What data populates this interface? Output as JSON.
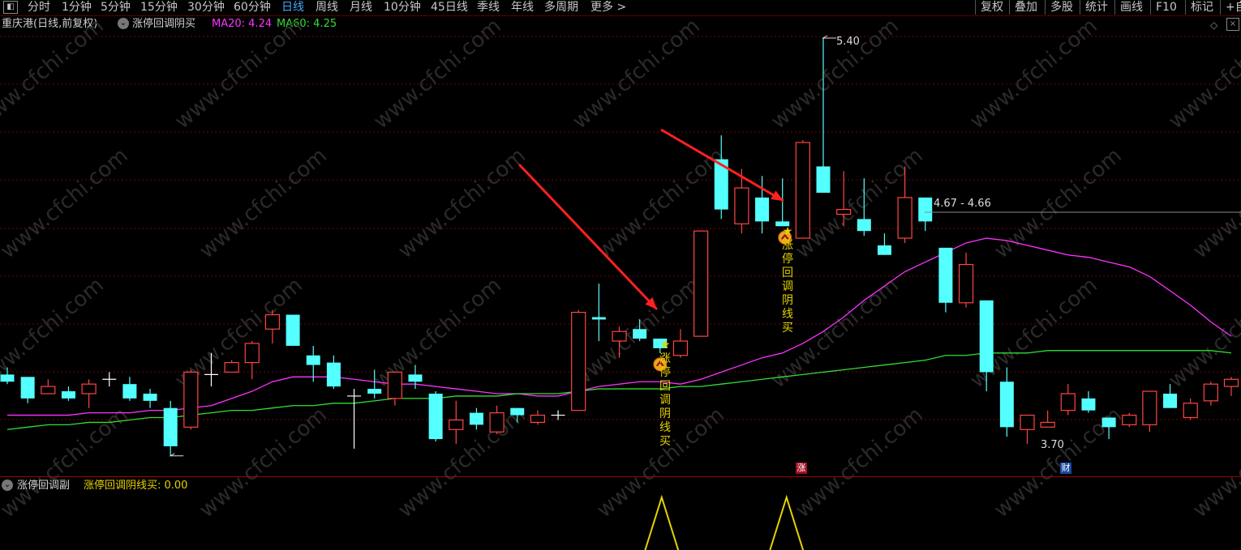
{
  "toolbar": {
    "toggle_icon": "window-toggle-icon",
    "periods": [
      "分时",
      "1分钟",
      "5分钟",
      "15分钟",
      "30分钟",
      "60分钟",
      "日线",
      "周线",
      "月线",
      "10分钟",
      "45日线",
      "季线",
      "年线",
      "多周期",
      "更多 >"
    ],
    "active_period": "日线",
    "right_buttons": [
      "复权",
      "叠加",
      "多股",
      "统计",
      "画线",
      "F10",
      "标记",
      "+自"
    ]
  },
  "main": {
    "stock_title": "重庆港(日线,前复权)",
    "indicator_name": "涨停回调阴买",
    "ma20_label": "MA20: 4.24",
    "ma60_label": "MA60: 4.25",
    "high_label": "5.40",
    "low_label": "3.70",
    "range_label": "4.67 - 4.66",
    "signal_text": "涨停回调阴线买",
    "zhang_badge": "涨",
    "cai_badge": "财"
  },
  "sub": {
    "indicator_name": "涨停回调副",
    "value_label": "涨停回调阴线买: 0.00"
  },
  "watermark": "www.cfchi.com",
  "colors": {
    "up": "#ff4444",
    "down": "#54ffff",
    "ma20": "#ff33ff",
    "ma60": "#33dd33",
    "signal": "#e6d200",
    "grid": "#7a0000",
    "arrow": "#ff2020",
    "active": "#3fa9ff"
  },
  "chart_data": {
    "type": "candlestick",
    "price_range": [
      3.7,
      5.4
    ],
    "candles": [
      {
        "o": 3.99,
        "c": 3.96,
        "h": 4.02,
        "l": 3.95
      },
      {
        "o": 3.98,
        "c": 3.89,
        "h": 3.98,
        "l": 3.87
      },
      {
        "o": 3.91,
        "c": 3.94,
        "h": 3.97,
        "l": 3.91
      },
      {
        "o": 3.92,
        "c": 3.89,
        "h": 3.94,
        "l": 3.88
      },
      {
        "o": 3.91,
        "c": 3.95,
        "h": 3.97,
        "l": 3.85
      },
      {
        "o": 3.97,
        "c": 3.97,
        "h": 4.0,
        "l": 3.94
      },
      {
        "o": 3.95,
        "c": 3.89,
        "h": 3.98,
        "l": 3.88
      },
      {
        "o": 3.91,
        "c": 3.88,
        "h": 3.93,
        "l": 3.85
      },
      {
        "o": 3.85,
        "c": 3.69,
        "h": 3.88,
        "l": 3.65
      },
      {
        "o": 3.77,
        "c": 4.0,
        "h": 4.01,
        "l": 3.76
      },
      {
        "o": 3.99,
        "c": 3.99,
        "h": 4.08,
        "l": 3.94
      },
      {
        "o": 4.0,
        "c": 4.04,
        "h": 4.05,
        "l": 4.0
      },
      {
        "o": 4.04,
        "c": 4.12,
        "h": 4.13,
        "l": 3.97
      },
      {
        "o": 4.18,
        "c": 4.24,
        "h": 4.26,
        "l": 4.12
      },
      {
        "o": 4.24,
        "c": 4.11,
        "h": 4.24,
        "l": 4.11
      },
      {
        "o": 4.07,
        "c": 4.03,
        "h": 4.11,
        "l": 3.96
      },
      {
        "o": 4.04,
        "c": 3.94,
        "h": 4.07,
        "l": 3.93
      },
      {
        "o": 3.9,
        "c": 3.9,
        "h": 3.93,
        "l": 3.68
      },
      {
        "o": 3.93,
        "c": 3.91,
        "h": 4.01,
        "l": 3.89
      },
      {
        "o": 3.89,
        "c": 4.0,
        "h": 4.0,
        "l": 3.86
      },
      {
        "o": 3.99,
        "c": 3.96,
        "h": 4.03,
        "l": 3.93
      },
      {
        "o": 3.91,
        "c": 3.72,
        "h": 3.92,
        "l": 3.71
      },
      {
        "o": 3.76,
        "c": 3.8,
        "h": 3.88,
        "l": 3.7
      },
      {
        "o": 3.83,
        "c": 3.78,
        "h": 3.85,
        "l": 3.76
      },
      {
        "o": 3.75,
        "c": 3.83,
        "h": 3.86,
        "l": 3.74
      },
      {
        "o": 3.85,
        "c": 3.82,
        "h": 3.85,
        "l": 3.79
      },
      {
        "o": 3.79,
        "c": 3.82,
        "h": 3.84,
        "l": 3.78
      },
      {
        "o": 3.82,
        "c": 3.82,
        "h": 3.84,
        "l": 3.8
      },
      {
        "o": 3.84,
        "c": 4.25,
        "h": 4.26,
        "l": 3.84
      },
      {
        "o": 4.23,
        "c": 4.22,
        "h": 4.37,
        "l": 4.13
      },
      {
        "o": 4.13,
        "c": 4.17,
        "h": 4.19,
        "l": 4.06
      },
      {
        "o": 4.18,
        "c": 4.14,
        "h": 4.22,
        "l": 4.13
      },
      {
        "o": 4.14,
        "c": 4.1,
        "h": 4.14,
        "l": 4.08
      },
      {
        "o": 4.07,
        "c": 4.13,
        "h": 4.18,
        "l": 4.06
      },
      {
        "o": 4.15,
        "c": 4.59,
        "h": 4.59,
        "l": 4.15
      },
      {
        "o": 4.89,
        "c": 4.68,
        "h": 4.99,
        "l": 4.64
      },
      {
        "o": 4.62,
        "c": 4.77,
        "h": 4.85,
        "l": 4.58
      },
      {
        "o": 4.73,
        "c": 4.63,
        "h": 4.82,
        "l": 4.58
      },
      {
        "o": 4.63,
        "c": 4.61,
        "h": 4.81,
        "l": 4.61
      },
      {
        "o": 4.56,
        "c": 4.96,
        "h": 4.97,
        "l": 4.56
      },
      {
        "o": 4.86,
        "c": 4.75,
        "h": 5.4,
        "l": 4.75
      },
      {
        "o": 4.66,
        "c": 4.68,
        "h": 4.84,
        "l": 4.61
      },
      {
        "o": 4.64,
        "c": 4.59,
        "h": 4.81,
        "l": 4.57
      },
      {
        "o": 4.53,
        "c": 4.49,
        "h": 4.58,
        "l": 4.49
      },
      {
        "o": 4.56,
        "c": 4.73,
        "h": 4.86,
        "l": 4.54
      },
      {
        "o": 4.73,
        "c": 4.63,
        "h": 4.73,
        "l": 4.59
      },
      {
        "o": 4.52,
        "c": 4.29,
        "h": 4.52,
        "l": 4.25
      },
      {
        "o": 4.29,
        "c": 4.45,
        "h": 4.5,
        "l": 4.27
      },
      {
        "o": 4.3,
        "c": 4.0,
        "h": 4.3,
        "l": 3.92
      },
      {
        "o": 3.96,
        "c": 3.77,
        "h": 4.02,
        "l": 3.73
      },
      {
        "o": 3.76,
        "c": 3.82,
        "h": 3.82,
        "l": 3.7
      },
      {
        "o": 3.77,
        "c": 3.79,
        "h": 3.84,
        "l": 3.77
      },
      {
        "o": 3.84,
        "c": 3.91,
        "h": 3.95,
        "l": 3.82
      },
      {
        "o": 3.89,
        "c": 3.84,
        "h": 3.92,
        "l": 3.83
      },
      {
        "o": 3.81,
        "c": 3.77,
        "h": 3.81,
        "l": 3.72
      },
      {
        "o": 3.78,
        "c": 3.82,
        "h": 3.83,
        "l": 3.77
      },
      {
        "o": 3.78,
        "c": 3.92,
        "h": 3.92,
        "l": 3.75
      },
      {
        "o": 3.91,
        "c": 3.85,
        "h": 3.95,
        "l": 3.85
      },
      {
        "o": 3.81,
        "c": 3.87,
        "h": 3.89,
        "l": 3.8
      },
      {
        "o": 3.88,
        "c": 3.95,
        "h": 3.96,
        "l": 3.86
      },
      {
        "o": 3.94,
        "c": 3.97,
        "h": 3.98,
        "l": 3.9
      }
    ],
    "ma20": [
      3.82,
      3.82,
      3.82,
      3.82,
      3.83,
      3.83,
      3.83,
      3.84,
      3.84,
      3.85,
      3.86,
      3.89,
      3.92,
      3.96,
      3.98,
      3.98,
      3.98,
      3.97,
      3.96,
      3.95,
      3.95,
      3.94,
      3.93,
      3.92,
      3.91,
      3.91,
      3.9,
      3.9,
      3.92,
      3.94,
      3.95,
      3.96,
      3.96,
      3.95,
      3.97,
      4.0,
      4.03,
      4.06,
      4.08,
      4.12,
      4.17,
      4.23,
      4.3,
      4.36,
      4.42,
      4.46,
      4.5,
      4.54,
      4.56,
      4.55,
      4.53,
      4.51,
      4.49,
      4.48,
      4.46,
      4.44,
      4.4,
      4.34,
      4.28,
      4.21,
      4.15
    ],
    "ma60": [
      3.76,
      3.77,
      3.78,
      3.78,
      3.79,
      3.79,
      3.8,
      3.81,
      3.81,
      3.82,
      3.83,
      3.84,
      3.84,
      3.85,
      3.86,
      3.86,
      3.87,
      3.87,
      3.88,
      3.89,
      3.89,
      3.89,
      3.9,
      3.9,
      3.9,
      3.91,
      3.91,
      3.91,
      3.92,
      3.93,
      3.93,
      3.93,
      3.93,
      3.94,
      3.94,
      3.95,
      3.96,
      3.97,
      3.98,
      3.99,
      4.0,
      4.01,
      4.02,
      4.03,
      4.04,
      4.05,
      4.07,
      4.07,
      4.08,
      4.08,
      4.08,
      4.09,
      4.09,
      4.09,
      4.09,
      4.09,
      4.09,
      4.09,
      4.09,
      4.09,
      4.08
    ],
    "signals": [
      32,
      38
    ],
    "sub_signal_values": [
      0,
      0,
      0,
      0,
      0,
      0,
      0,
      0,
      0,
      0,
      0,
      0,
      0,
      0,
      0,
      0,
      0,
      0,
      0,
      0,
      0,
      0,
      0,
      0,
      0,
      0,
      0,
      0,
      0,
      0,
      0,
      0,
      1,
      0,
      0,
      0,
      0,
      0,
      1,
      0,
      0,
      0,
      0,
      0,
      0,
      0,
      0,
      0,
      0,
      0,
      0,
      0,
      0,
      0,
      0,
      0,
      0,
      0,
      0,
      0,
      0
    ]
  }
}
